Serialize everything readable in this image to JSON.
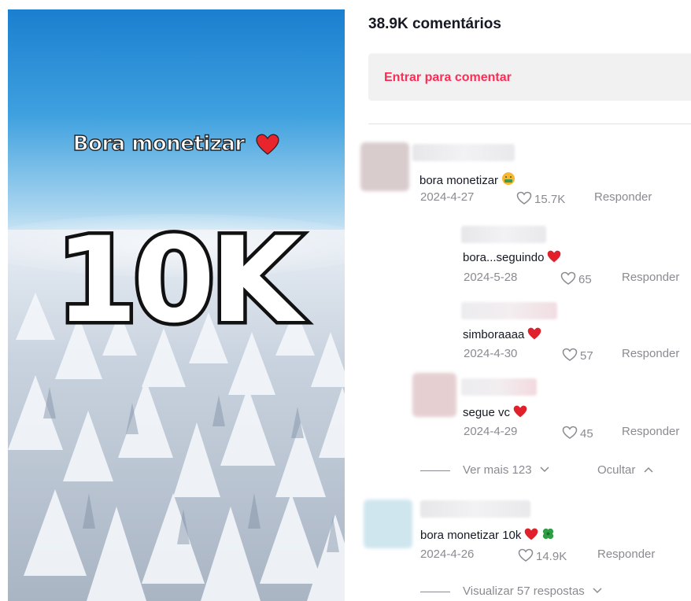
{
  "video": {
    "caption_small": "Bora monetizar",
    "caption_big": "10K"
  },
  "comments_header": {
    "count_label": "38.9K comentários",
    "login_prompt": "Entrar para comentar"
  },
  "comments": [
    {
      "text": "bora monetizar",
      "emoji": "money-mouth-face",
      "date": "2024-4-27",
      "likes": "15.7K",
      "reply_label": "Responder"
    },
    {
      "text": "bora...seguindo",
      "emoji": "red-heart",
      "date": "2024-5-28",
      "likes": "65",
      "reply_label": "Responder"
    },
    {
      "text": "simboraaaa",
      "emoji": "red-heart",
      "date": "2024-4-30",
      "likes": "57",
      "reply_label": "Responder"
    },
    {
      "text": "segue vc",
      "emoji": "red-heart",
      "date": "2024-4-29",
      "likes": "45",
      "reply_label": "Responder"
    },
    {
      "text": "bora monetizar 10k",
      "emoji": "red-heart, four-leaf-clover",
      "date": "2024-4-26",
      "likes": "14.9K",
      "reply_label": "Responder"
    }
  ],
  "thread_controls": {
    "see_more": "Ver mais 123",
    "hide": "Ocultar",
    "view_replies": "Visualizar 57 respostas"
  },
  "colors": {
    "accent_red": "#fe2c55",
    "meta_gray": "#8a8b91",
    "text_dark": "#161823",
    "login_bg": "#f1f1f2"
  }
}
